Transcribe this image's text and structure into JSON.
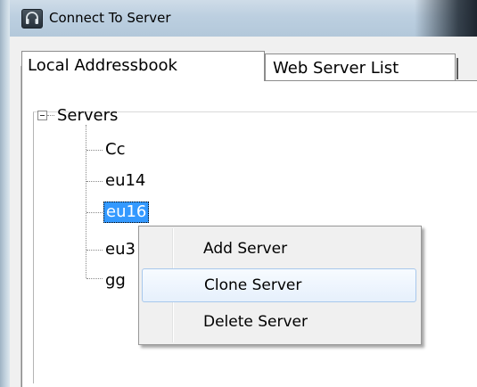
{
  "window": {
    "title": "Connect To Server",
    "icon": "headset-icon"
  },
  "tabs": [
    {
      "label": "Local Addressbook",
      "active": true
    },
    {
      "label": "Web Server List",
      "active": false
    }
  ],
  "tree": {
    "root": {
      "label": "Servers",
      "expanded": true
    },
    "children": [
      {
        "label": "Cc",
        "selected": false
      },
      {
        "label": "eu14",
        "selected": false
      },
      {
        "label": "eu16",
        "selected": true
      },
      {
        "label": "eu3",
        "selected": false
      },
      {
        "label": "gg",
        "selected": false
      }
    ]
  },
  "context_menu": {
    "items": [
      {
        "label": "Add Server",
        "highlighted": false
      },
      {
        "label": "Clone Server",
        "highlighted": true
      },
      {
        "label": "Delete Server",
        "highlighted": false
      }
    ]
  },
  "colors": {
    "selection": "#3399ff",
    "menu_highlight_border": "#a8c8ec"
  }
}
